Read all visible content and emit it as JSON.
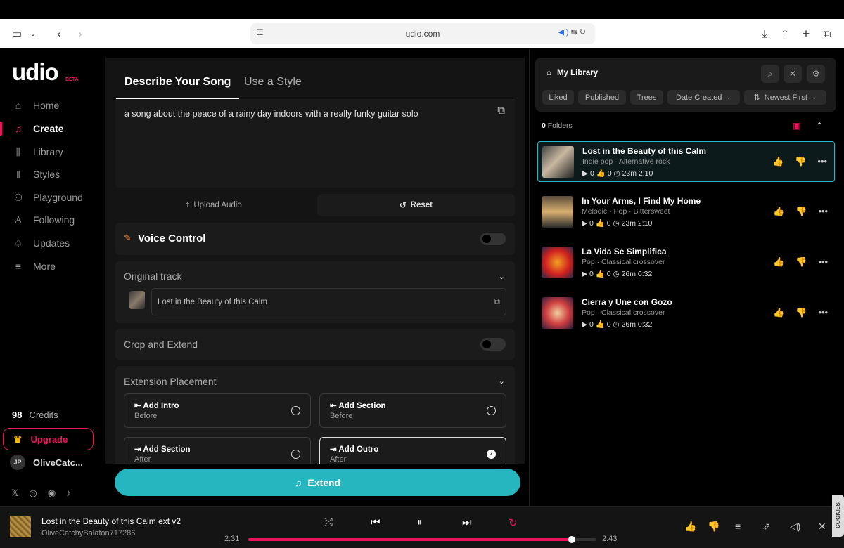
{
  "browser": {
    "url": "udio.com"
  },
  "app": {
    "logo": "udio",
    "beta": "BETA"
  },
  "sidebar": {
    "items": [
      {
        "label": "Home",
        "icon": "home-icon"
      },
      {
        "label": "Create",
        "icon": "music-note-icon",
        "active": true
      },
      {
        "label": "Library",
        "icon": "library-icon"
      },
      {
        "label": "Styles",
        "icon": "waveform-icon"
      },
      {
        "label": "Playground",
        "icon": "playground-icon"
      },
      {
        "label": "Following",
        "icon": "person-icon"
      },
      {
        "label": "Updates",
        "icon": "bell-icon"
      },
      {
        "label": "More",
        "icon": "menu-icon"
      }
    ],
    "credits_count": "98",
    "credits_label": "Credits",
    "upgrade_label": "Upgrade",
    "user_initials": "JP",
    "user_name": "OliveCatc..."
  },
  "create": {
    "tabs": [
      "Describe Your Song",
      "Use a Style"
    ],
    "prompt": "a song about the peace of a rainy day indoors with a really funky guitar solo",
    "upload_label": "Upload Audio",
    "reset_label": "Reset",
    "voice_control": "Voice Control",
    "original_track_title": "Original track",
    "original_track_value": "Lost in the Beauty of this Calm",
    "crop_extend": "Crop and Extend",
    "extension_placement": "Extension Placement",
    "options": [
      {
        "label": "Add Intro",
        "sub": "Before",
        "selected": false
      },
      {
        "label": "Add Section",
        "sub": "Before",
        "selected": false
      },
      {
        "label": "Add Section",
        "sub": "After",
        "selected": false
      },
      {
        "label": "Add Outro",
        "sub": "After",
        "selected": true
      }
    ],
    "extend_label": "Extend"
  },
  "library": {
    "title": "My Library",
    "filters": [
      "Liked",
      "Published",
      "Trees",
      "Date Created",
      "Newest First"
    ],
    "folders_count": "0",
    "folders_label": "Folders",
    "songs": [
      {
        "name": "Lost in the Beauty of this Calm",
        "genres": "Indie pop  ·  Alternative rock",
        "stats": "▶ 0   👍 0   ◷ 23m  2:10",
        "selected": true
      },
      {
        "name": "In Your Arms, I Find My Home",
        "genres": "Melodic  ·  Pop  ·  Bittersweet",
        "stats": "▶ 0   👍 0   ◷ 23m  2:10",
        "selected": false
      },
      {
        "name": "La Vida Se Simplifica",
        "genres": "Pop  ·  Classical crossover",
        "stats": "▶ 0   👍 0   ◷ 26m  0:32",
        "selected": false
      },
      {
        "name": "Cierra y Une con Gozo",
        "genres": "Pop  ·  Classical crossover",
        "stats": "▶ 0   👍 0   ◷ 26m  0:32",
        "selected": false
      }
    ]
  },
  "player": {
    "title": "Lost in the Beauty of this Calm ext v2",
    "artist": "OliveCatchyBalafon717286",
    "current": "2:31",
    "total": "2:43",
    "progress": 0.93
  },
  "cookie": "COOKIES",
  "colors": {
    "accent": "#e8175d",
    "teal": "#25b6bf"
  }
}
